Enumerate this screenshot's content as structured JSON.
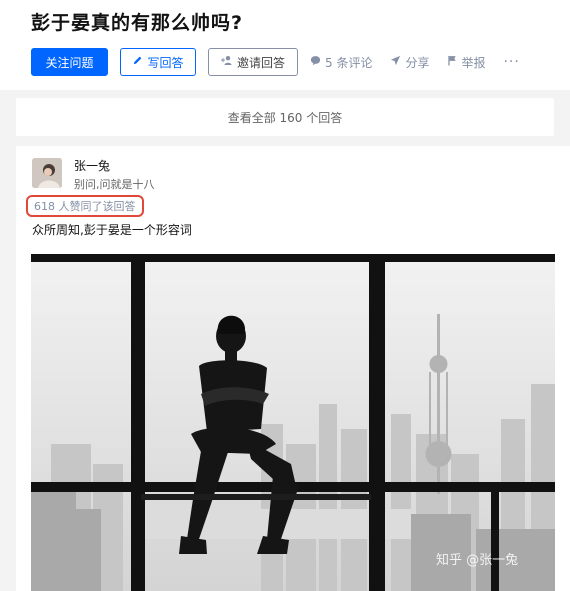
{
  "question": {
    "title": "彭于晏真的有那么帅吗?",
    "actions": {
      "follow_label": "关注问题",
      "write_label": "写回答",
      "invite_label": "邀请回答",
      "comments_label": "5 条评论",
      "share_label": "分享",
      "report_label": "举报",
      "more_label": "···"
    }
  },
  "view_all_label": "查看全部 160 个回答",
  "answer": {
    "author_name": "张一兔",
    "author_bio": "别问,问就是十八",
    "vote_text": "618 人赞同了该回答",
    "content": "众所周知,彭于晏是一个形容词",
    "image": {
      "description_watermark": "知乎 @张一兔"
    }
  },
  "colors": {
    "primary": "#0066ff",
    "highlight_box": "#e0493a",
    "muted": "#8590a6",
    "background": "#f3f3f4"
  },
  "icons": {
    "write": "pencil-icon",
    "invite": "add-user-icon",
    "comment": "comment-bubble-icon",
    "share": "paper-plane-icon",
    "report": "flag-icon"
  }
}
